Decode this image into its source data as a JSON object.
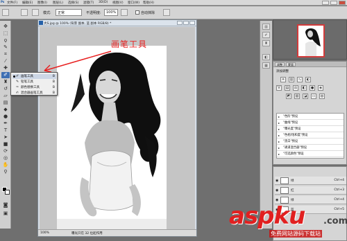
{
  "menubar": {
    "logo": "Ps",
    "items": [
      "文件(F)",
      "编辑(E)",
      "图像(I)",
      "图层(L)",
      "选择(S)",
      "滤镜(T)",
      "3D(D)",
      "视图(V)",
      "窗口(W)",
      "帮助(H)"
    ]
  },
  "options": {
    "mode_label": "模式:",
    "mode_value": "正常",
    "opacity_label": "不透明度:",
    "opacity_value": "100%",
    "auto_erase_label": "自动抹除"
  },
  "document": {
    "title": "大S.jpg @ 100% (背景 副本, 蓝 副本 RGB/8) *",
    "zoom": "100%",
    "status_info": "曝光只在 32 位起作用"
  },
  "flyout": {
    "items": [
      {
        "label": "画笔工具",
        "key": "B",
        "selected": true
      },
      {
        "label": "铅笔工具",
        "key": "B",
        "selected": false
      },
      {
        "label": "颜色替换工具",
        "key": "B",
        "selected": false
      },
      {
        "label": "混合器画笔工具",
        "key": "B",
        "selected": false
      }
    ]
  },
  "annotation": {
    "text": "画笔工具",
    "color": "#e82020"
  },
  "panels": {
    "adjust_tabs": [
      "调整",
      "蒙版"
    ],
    "adjust_title": "添加调整",
    "presets": [
      "\"色阶\"预设",
      "\"曲线\"预设",
      "\"曝光度\"预设",
      "\"色相/饱和度\"预设",
      "\"黑白\"预设",
      "\"通道混合器\"预设",
      "\"可选颜色\"预设"
    ],
    "layers": [
      {
        "name": "绿",
        "key": "Ctrl+4"
      },
      {
        "name": "红",
        "key": "Ctrl+3"
      },
      {
        "name": "绿",
        "key": "Ctrl+4"
      },
      {
        "name": "蓝",
        "key": "Ctrl+5"
      }
    ]
  },
  "watermark": {
    "logo": "aspku",
    "tld": ".com",
    "sub": "免费网站源码下载站"
  }
}
